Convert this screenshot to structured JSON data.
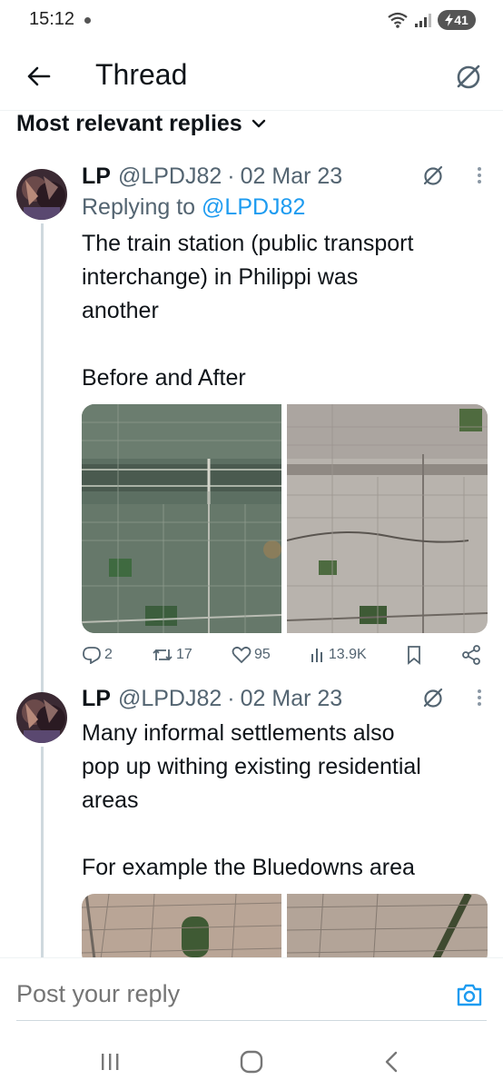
{
  "status": {
    "time": "15:12",
    "battery": "41"
  },
  "header": {
    "title": "Thread",
    "back_icon": "arrow-left-icon",
    "grok_icon": "grok-icon"
  },
  "sort": {
    "label": "Most relevant replies"
  },
  "tweets": [
    {
      "name": "LP",
      "handle": "@LPDJ82",
      "sep": "·",
      "date": "02 Mar 23",
      "replying_prefix": "Replying to ",
      "replying_handle": "@LPDJ82",
      "text_lines": [
        "The train station (public transport",
        "interchange) in Philippi was",
        "another"
      ],
      "text_line2": "Before and After",
      "actions": {
        "replies": "2",
        "reposts": "17",
        "likes": "95",
        "views": "13.9K"
      }
    },
    {
      "name": "LP",
      "handle": "@LPDJ82",
      "sep": "·",
      "date": "02 Mar 23",
      "text_lines": [
        "Many informal settlements also",
        "pop up withing existing residential",
        "areas"
      ],
      "text_line2": "For example the Bluedowns area"
    }
  ],
  "reply": {
    "placeholder": "Post your reply"
  },
  "colors": {
    "accent": "#1d9bf0",
    "muted": "#536471",
    "text": "#0f1419"
  }
}
